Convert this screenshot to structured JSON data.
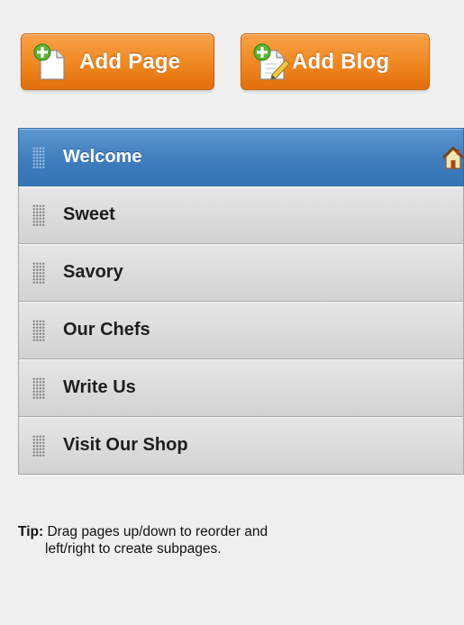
{
  "toolbar": {
    "add_page_label": "Add Page",
    "add_blog_label": "Add Blog",
    "add_page_icon": "add-page-icon",
    "add_blog_icon": "add-blog-icon",
    "accent_color": "#f08a23"
  },
  "pages": {
    "items": [
      {
        "label": "Welcome",
        "active": true,
        "home": true
      },
      {
        "label": "Sweet",
        "active": false
      },
      {
        "label": "Savory",
        "active": false
      },
      {
        "label": "Our Chefs",
        "active": false
      },
      {
        "label": "Write Us",
        "active": false
      },
      {
        "label": "Visit Our Shop",
        "active": false
      }
    ],
    "active_color": "#3f7dbd",
    "home_icon": "home-icon",
    "drag_handle_icon": "drag-handle-icon"
  },
  "tip": {
    "label": "Tip:",
    "line1": "Drag pages up/down to reorder and",
    "line2": "left/right to create subpages."
  }
}
